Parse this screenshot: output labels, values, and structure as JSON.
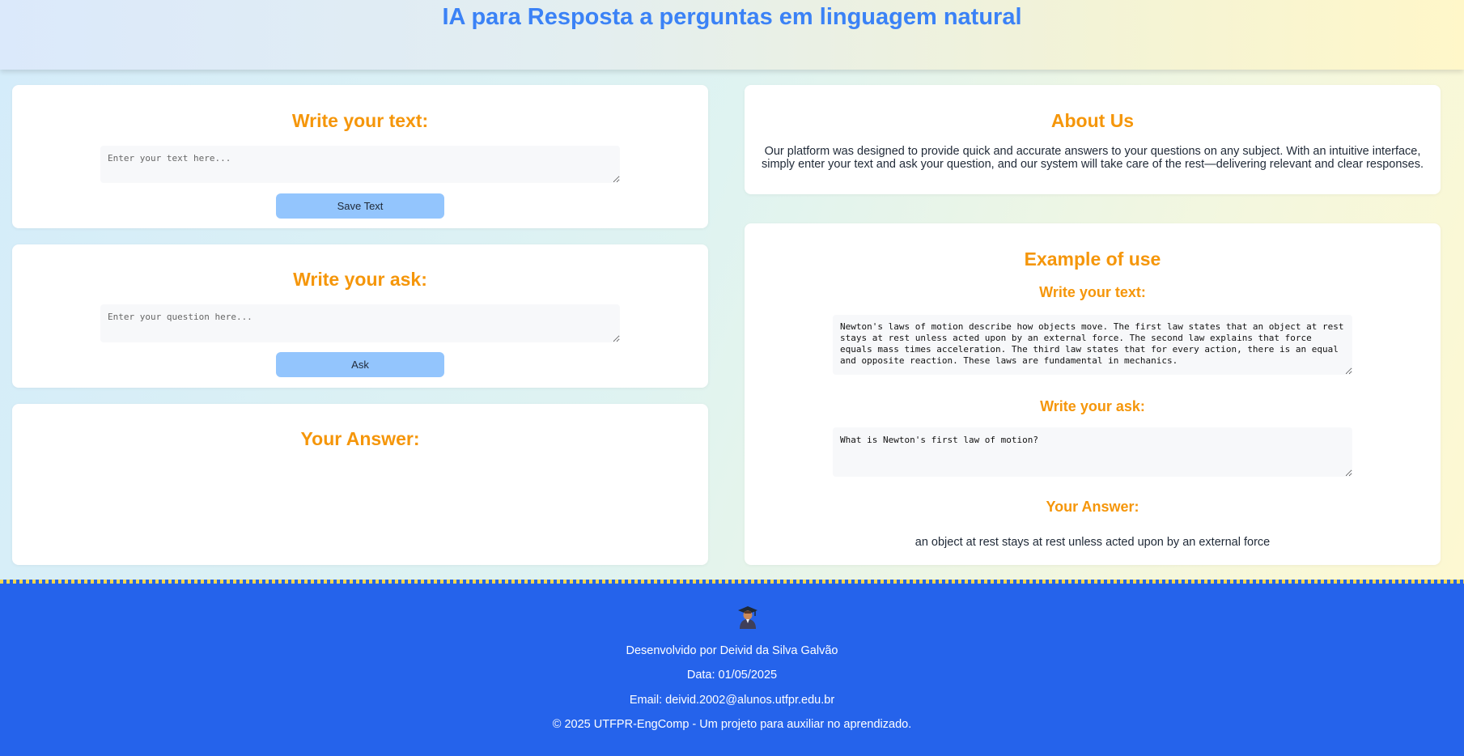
{
  "header": {
    "title": "IA para Resposta a perguntas em linguagem natural"
  },
  "text_card": {
    "heading": "Write your text:",
    "placeholder": "Enter your text here...",
    "save_label": "Save Text"
  },
  "ask_card": {
    "heading": "Write your ask:",
    "placeholder": "Enter your question here...",
    "ask_label": "Ask"
  },
  "answer_card": {
    "heading": "Your Answer:"
  },
  "about": {
    "heading": "About Us",
    "body": "Our platform was designed to provide quick and accurate answers to your questions on any subject. With an intuitive interface, simply enter your text and ask your question, and our system will take care of the rest—delivering relevant and clear responses."
  },
  "example": {
    "heading": "Example of use",
    "text_heading": "Write your text:",
    "text_value": "Newton's laws of motion describe how objects move. The first law states that an object at rest stays at rest unless acted upon by an external force. The second law explains that force equals mass times acceleration. The third law states that for every action, there is an equal and opposite reaction. These laws are fundamental in mechanics.",
    "ask_heading": "Write your ask:",
    "ask_value": "What is Newton's first law of motion?",
    "answer_heading": "Your Answer:",
    "answer_value": "an object at rest stays at rest unless acted upon by an external force"
  },
  "footer": {
    "icon": "graduate-icon",
    "developer": "Desenvolvido por Deivid da Silva Galvão",
    "date": "Data: 01/05/2025",
    "email": "Email: deivid.2002@alunos.utfpr.edu.br",
    "copyright": "© 2025 UTFPR-EngComp - Um projeto para auxiliar no aprendizado."
  },
  "colors": {
    "title_blue": "#3b82f6",
    "heading_orange": "#f5960a",
    "button_blue": "#93c5fd",
    "footer_blue": "#2563eb",
    "footer_dash_yellow": "#f3d64b"
  }
}
